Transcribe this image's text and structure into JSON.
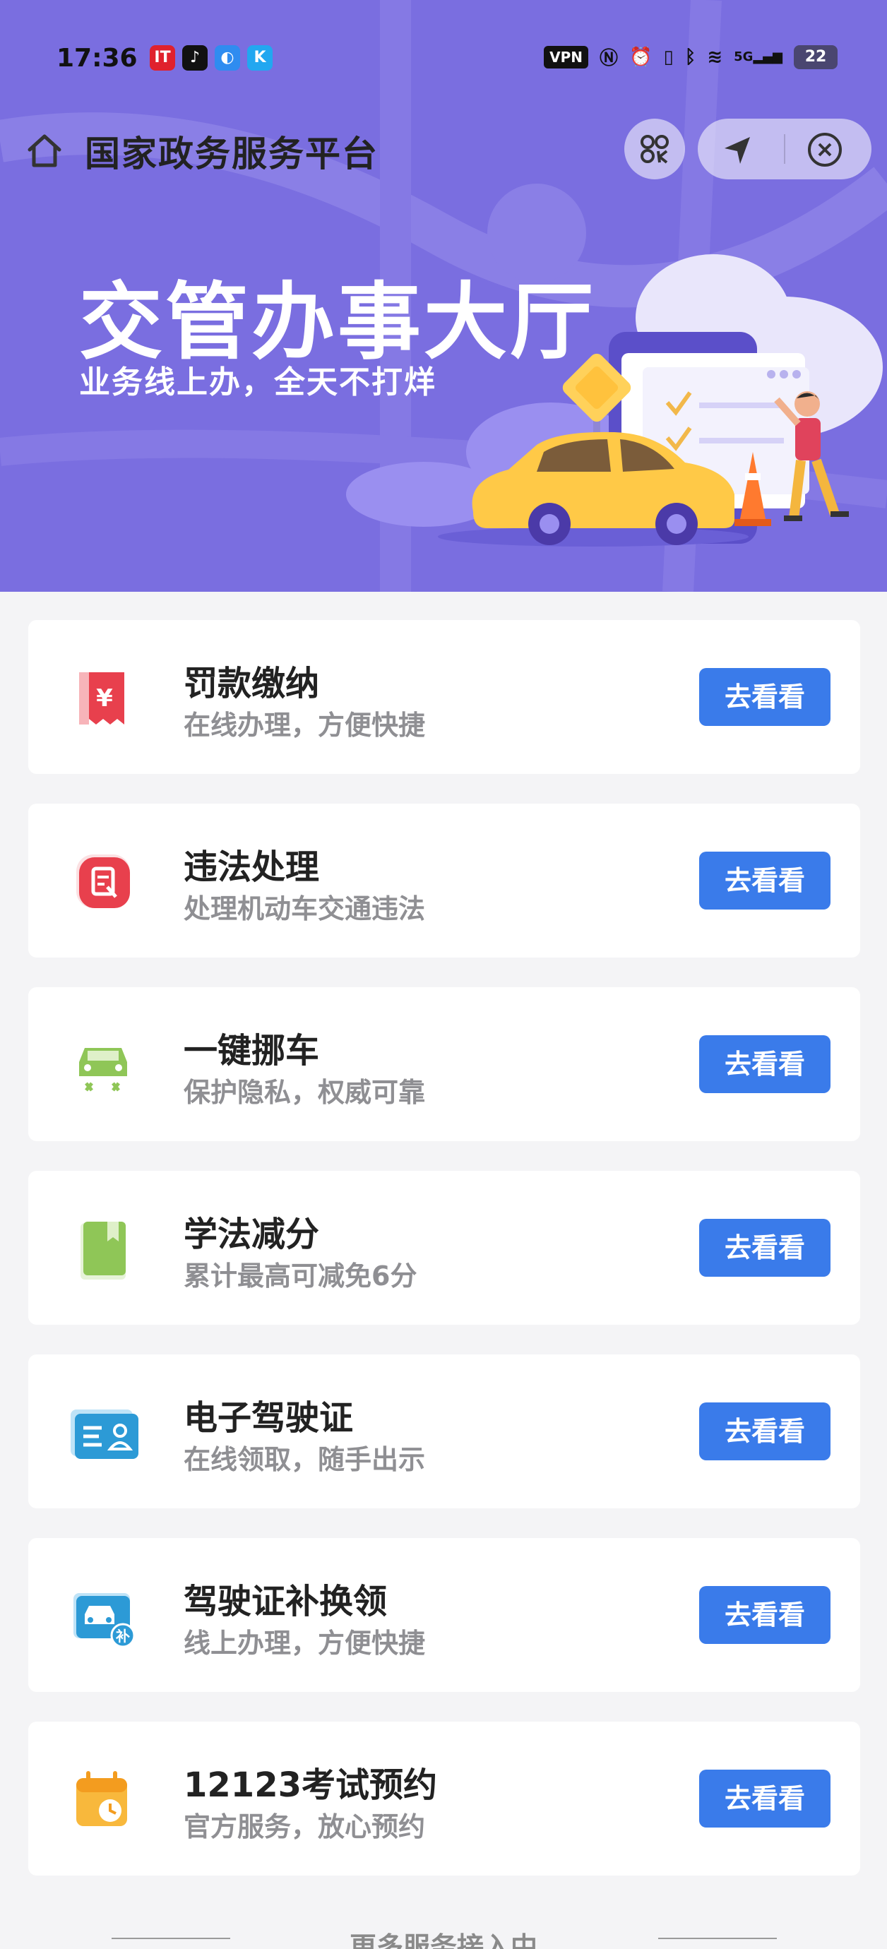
{
  "status_bar": {
    "time": "17:36",
    "vpn_label": "VPN",
    "network_label": "5G",
    "battery_level": "22"
  },
  "nav": {
    "title": "国家政务服务平台"
  },
  "banner": {
    "title": "交管办事大厅",
    "subtitle": "业务线上办，全天不打烊"
  },
  "services": [
    {
      "name": "罚款缴纳",
      "desc": "在线办理，方便快捷",
      "button": "去看看",
      "icon": "fine-payment-icon"
    },
    {
      "name": "违法处理",
      "desc": "处理机动车交通违法",
      "button": "去看看",
      "icon": "violation-handling-icon"
    },
    {
      "name": "一键挪车",
      "desc": "保护隐私，权威可靠",
      "button": "去看看",
      "icon": "move-car-icon"
    },
    {
      "name": "学法减分",
      "desc": "累计最高可减免6分",
      "button": "去看看",
      "icon": "study-book-icon"
    },
    {
      "name": "电子驾驶证",
      "desc": "在线领取，随手出示",
      "button": "去看看",
      "icon": "e-license-icon"
    },
    {
      "name": "驾驶证补换领",
      "desc": "线上办理，方便快捷",
      "button": "去看看",
      "icon": "license-renewal-icon"
    },
    {
      "name": "12123考试预约",
      "desc": "官方服务，放心预约",
      "button": "去看看",
      "icon": "exam-calendar-icon"
    }
  ],
  "footer": {
    "text": "更多服务接入中"
  },
  "colors": {
    "hero": "#7a6ee0",
    "button": "#3a7bea",
    "background": "#f4f4f6"
  }
}
